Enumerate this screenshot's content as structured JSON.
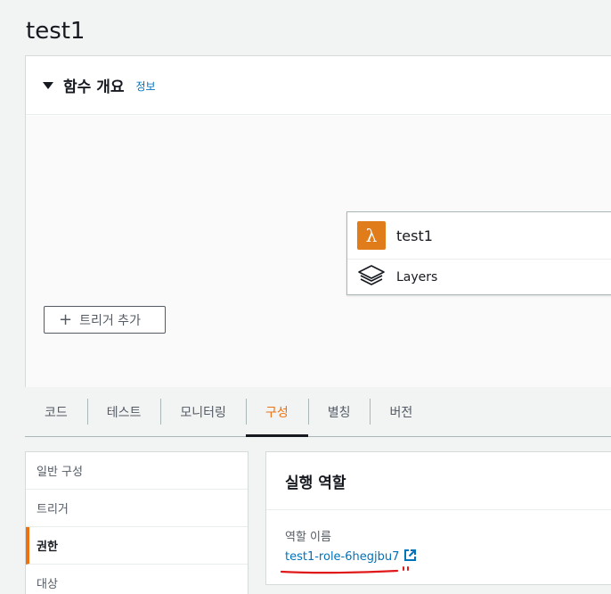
{
  "page": {
    "title": "test1"
  },
  "overview": {
    "title": "함수 개요",
    "info_link": "정보",
    "function": {
      "name": "test1",
      "icon": "lambda-icon"
    },
    "layers": {
      "label": "Layers",
      "icon": "layers-icon"
    },
    "add_trigger": "트리거 추가"
  },
  "tabs": [
    {
      "label": "코드",
      "active": false
    },
    {
      "label": "테스트",
      "active": false
    },
    {
      "label": "모니터링",
      "active": false
    },
    {
      "label": "구성",
      "active": true
    },
    {
      "label": "별칭",
      "active": false
    },
    {
      "label": "버전",
      "active": false
    }
  ],
  "side_nav": [
    {
      "label": "일반 구성",
      "active": false
    },
    {
      "label": "트리거",
      "active": false
    },
    {
      "label": "권한",
      "active": true
    },
    {
      "label": "대상",
      "active": false
    }
  ],
  "role_panel": {
    "title": "실행 역할",
    "role_name_label": "역할 이름",
    "role_name": "test1-role-6hegjbu7"
  },
  "colors": {
    "accent": "#ec7211",
    "link": "#0073bb",
    "lambda": "#e07c1a",
    "annotation": "#e0191b"
  }
}
